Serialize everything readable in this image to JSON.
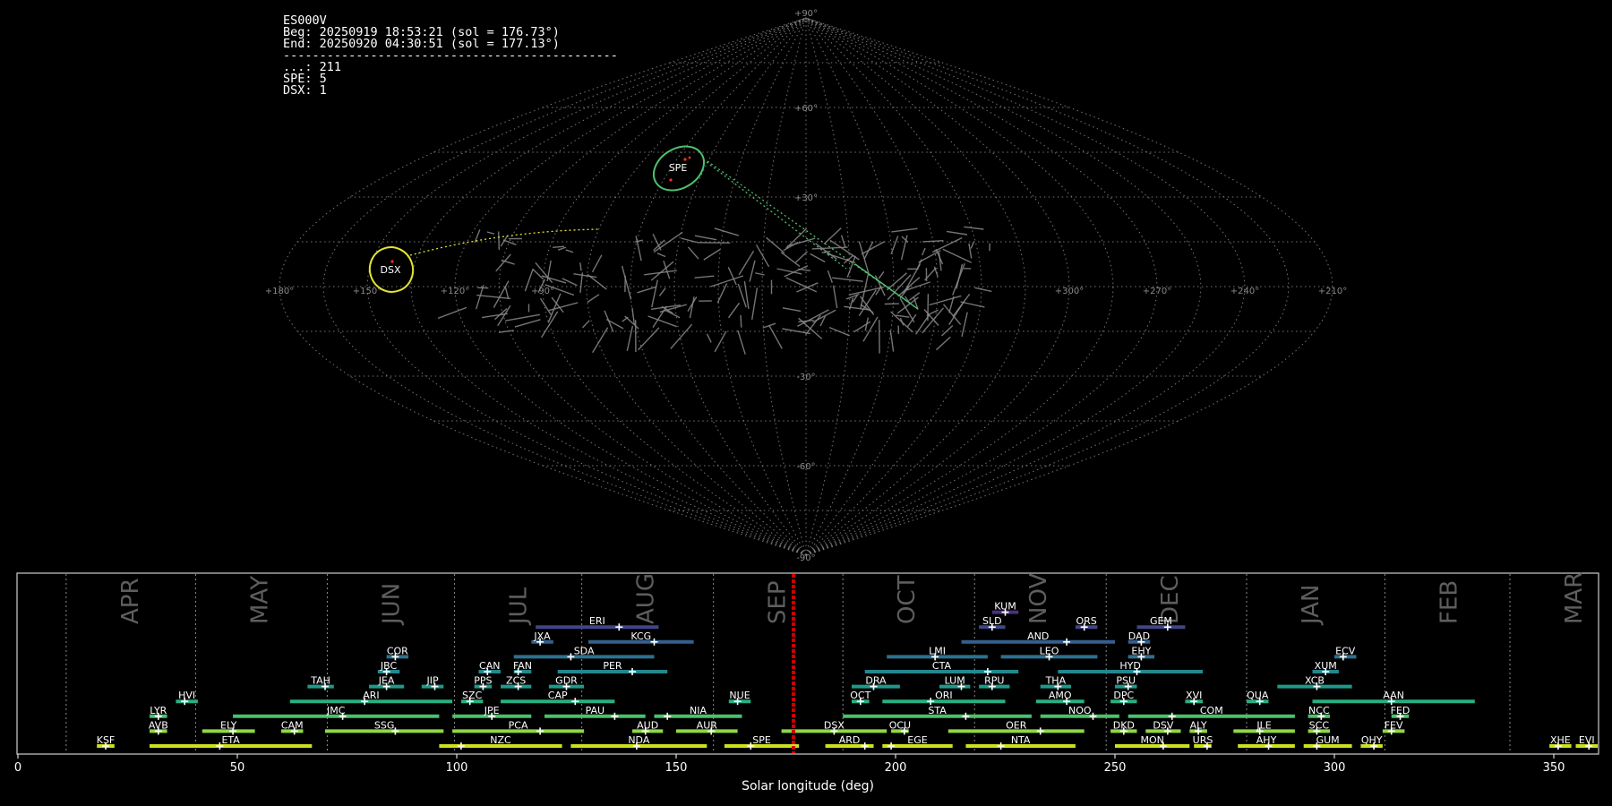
{
  "header": {
    "station": "ES000V",
    "begin": "Beg: 20250919 18:53:21 (sol = 176.73°)",
    "end": "End: 20250920 04:30:51 (sol = 177.13°)",
    "divider": "----------------------------------------------",
    "counts": [
      {
        "label": "...: 211"
      },
      {
        "label": "SPE: 5"
      },
      {
        "label": "DSX: 1"
      }
    ]
  },
  "colors": {
    "background": "#000000",
    "grid": "#8a8a8a",
    "sporadic_trail": "#8a8a8a",
    "spe_shower": "#4fc06e",
    "dsx_shower": "#e2e233",
    "current_sol_marker": "#cc0000",
    "radiant_point": "#ff3030"
  },
  "sky_map": {
    "projection": "sinusoidal all-sky (equal-area)",
    "grid": true,
    "lon_tick_labels": [
      "+180°",
      "+150°",
      "+120°",
      "+90°",
      "+300°",
      "+270°",
      "+240°",
      "+210°",
      "+180°"
    ],
    "lat_tick_labels": [
      "+90°",
      "+60°",
      "+30°",
      "-30°",
      "-60°",
      "-90°"
    ],
    "shower_radiants": [
      {
        "code": "SPE",
        "label": "SPE",
        "color": "#4fc06e"
      },
      {
        "code": "DSX",
        "label": "DSX",
        "color": "#e2e233"
      }
    ],
    "sporadic_meteor_count": 211
  },
  "chart_data": {
    "type": "timeline",
    "title": "",
    "xlabel": "Solar longitude (deg)",
    "ylabel": "",
    "xlim": [
      0,
      360
    ],
    "x_ticks": [
      0,
      50,
      100,
      150,
      200,
      250,
      300,
      350
    ],
    "current_solar_longitude": 176.73,
    "month_starts": [
      {
        "label": "APR",
        "sol": 11
      },
      {
        "label": "MAY",
        "sol": 40.5
      },
      {
        "label": "JUN",
        "sol": 70.5
      },
      {
        "label": "JUL",
        "sol": 99.5
      },
      {
        "label": "AUG",
        "sol": 128.5
      },
      {
        "label": "SEP",
        "sol": 158.5
      },
      {
        "label": "OCT",
        "sol": 188
      },
      {
        "label": "NOV",
        "sol": 218
      },
      {
        "label": "DEC",
        "sol": 248
      },
      {
        "label": "JAN",
        "sol": 280
      },
      {
        "label": "FEB",
        "sol": 311.5
      },
      {
        "label": "MAR",
        "sol": 340
      }
    ],
    "showers": [
      {
        "code": "KSF",
        "start": 18,
        "end": 22,
        "peak": 20,
        "row": 0
      },
      {
        "code": "ETA",
        "start": 30,
        "end": 67,
        "peak": 46,
        "row": 0
      },
      {
        "code": "NZC",
        "start": 96,
        "end": 124,
        "peak": 101,
        "row": 0
      },
      {
        "code": "NDA",
        "start": 126,
        "end": 157,
        "peak": 141,
        "row": 0
      },
      {
        "code": "SPE",
        "start": 161,
        "end": 178,
        "peak": 167,
        "row": 0
      },
      {
        "code": "ARD",
        "start": 184,
        "end": 195,
        "peak": 193,
        "row": 0
      },
      {
        "code": "EGE",
        "start": 197,
        "end": 213,
        "peak": 199,
        "row": 0
      },
      {
        "code": "NTA",
        "start": 216,
        "end": 241,
        "peak": 224,
        "row": 0
      },
      {
        "code": "MON",
        "start": 250,
        "end": 267,
        "peak": 261,
        "row": 0
      },
      {
        "code": "URS",
        "start": 268,
        "end": 272,
        "peak": 271,
        "row": 0
      },
      {
        "code": "AHY",
        "start": 278,
        "end": 291,
        "peak": 285,
        "row": 0
      },
      {
        "code": "GUM",
        "start": 293,
        "end": 304,
        "peak": 296,
        "row": 0
      },
      {
        "code": "QHY",
        "start": 306,
        "end": 311,
        "peak": 309,
        "row": 0
      },
      {
        "code": "XHE",
        "start": 349,
        "end": 354,
        "peak": 351,
        "row": 0
      },
      {
        "code": "EVI",
        "start": 355,
        "end": 360,
        "peak": 358,
        "row": 0
      },
      {
        "code": "AVB",
        "start": 30,
        "end": 34,
        "peak": 32,
        "row": 1
      },
      {
        "code": "ELY",
        "start": 42,
        "end": 54,
        "peak": 49,
        "row": 1
      },
      {
        "code": "CAM",
        "start": 60,
        "end": 65,
        "peak": 63,
        "row": 1
      },
      {
        "code": "SSG",
        "start": 70,
        "end": 97,
        "peak": 86,
        "row": 1
      },
      {
        "code": "PCA",
        "start": 99,
        "end": 129,
        "peak": 119,
        "row": 1
      },
      {
        "code": "AUD",
        "start": 140,
        "end": 147,
        "peak": 143,
        "row": 1
      },
      {
        "code": "AUR",
        "start": 150,
        "end": 164,
        "peak": 158,
        "row": 1
      },
      {
        "code": "DSX",
        "start": 174,
        "end": 198,
        "peak": 186,
        "row": 1
      },
      {
        "code": "OCU",
        "start": 199,
        "end": 203,
        "peak": 202,
        "row": 1
      },
      {
        "code": "OER",
        "start": 212,
        "end": 243,
        "peak": 233,
        "row": 1
      },
      {
        "code": "DKD",
        "start": 249,
        "end": 255,
        "peak": 252,
        "row": 1
      },
      {
        "code": "DSV",
        "start": 257,
        "end": 265,
        "peak": 262,
        "row": 1
      },
      {
        "code": "ALY",
        "start": 267,
        "end": 271,
        "peak": 269,
        "row": 1
      },
      {
        "code": "JLE",
        "start": 277,
        "end": 291,
        "peak": 283,
        "row": 1
      },
      {
        "code": "SCC",
        "start": 294,
        "end": 299,
        "peak": 296,
        "row": 1
      },
      {
        "code": "FEV",
        "start": 311,
        "end": 316,
        "peak": 313,
        "row": 1
      },
      {
        "code": "LYR",
        "start": 30,
        "end": 34,
        "peak": 32,
        "row": 2
      },
      {
        "code": "JMC",
        "start": 49,
        "end": 96,
        "peak": 74,
        "row": 2
      },
      {
        "code": "JPE",
        "start": 99,
        "end": 117,
        "peak": 108,
        "row": 2
      },
      {
        "code": "PAU",
        "start": 120,
        "end": 143,
        "peak": 136,
        "row": 2
      },
      {
        "code": "NIA",
        "start": 145,
        "end": 165,
        "peak": 148,
        "row": 2
      },
      {
        "code": "STA",
        "start": 188,
        "end": 231,
        "peak": 216,
        "row": 2
      },
      {
        "code": "NOO",
        "start": 233,
        "end": 251,
        "peak": 245,
        "row": 2
      },
      {
        "code": "COM",
        "start": 253,
        "end": 291,
        "peak": 263,
        "row": 2
      },
      {
        "code": "NCC",
        "start": 294,
        "end": 299,
        "peak": 297,
        "row": 2
      },
      {
        "code": "FED",
        "start": 313,
        "end": 317,
        "peak": 315,
        "row": 2
      },
      {
        "code": "HVI",
        "start": 36,
        "end": 41,
        "peak": 38,
        "row": 3
      },
      {
        "code": "ARI",
        "start": 62,
        "end": 99,
        "peak": 79,
        "row": 3
      },
      {
        "code": "SZC",
        "start": 101,
        "end": 106,
        "peak": 103,
        "row": 3
      },
      {
        "code": "CAP",
        "start": 110,
        "end": 136,
        "peak": 127,
        "row": 3
      },
      {
        "code": "NUE",
        "start": 162,
        "end": 167,
        "peak": 164,
        "row": 3
      },
      {
        "code": "OCT",
        "start": 190,
        "end": 194,
        "peak": 192,
        "row": 3
      },
      {
        "code": "ORI",
        "start": 197,
        "end": 225,
        "peak": 208,
        "row": 3
      },
      {
        "code": "AMO",
        "start": 232,
        "end": 243,
        "peak": 239,
        "row": 3
      },
      {
        "code": "DPC",
        "start": 249,
        "end": 255,
        "peak": 252,
        "row": 3
      },
      {
        "code": "XVI",
        "start": 266,
        "end": 270,
        "peak": 268,
        "row": 3
      },
      {
        "code": "QUA",
        "start": 280,
        "end": 285,
        "peak": 283,
        "row": 3
      },
      {
        "code": "AAN",
        "start": 295,
        "end": 332,
        "peak": 313,
        "row": 3
      },
      {
        "code": "TAH",
        "start": 66,
        "end": 72,
        "peak": 70,
        "row": 4
      },
      {
        "code": "JEA",
        "start": 80,
        "end": 88,
        "peak": 84,
        "row": 4
      },
      {
        "code": "JIP",
        "start": 92,
        "end": 97,
        "peak": 95,
        "row": 4
      },
      {
        "code": "PPS",
        "start": 104,
        "end": 108,
        "peak": 106,
        "row": 4
      },
      {
        "code": "ZCS",
        "start": 110,
        "end": 117,
        "peak": 114,
        "row": 4
      },
      {
        "code": "GDR",
        "start": 121,
        "end": 129,
        "peak": 125,
        "row": 4
      },
      {
        "code": "DRA",
        "start": 190,
        "end": 201,
        "peak": 195,
        "row": 4
      },
      {
        "code": "LUM",
        "start": 210,
        "end": 217,
        "peak": 215,
        "row": 4
      },
      {
        "code": "RPU",
        "start": 219,
        "end": 226,
        "peak": 222,
        "row": 4
      },
      {
        "code": "THA",
        "start": 233,
        "end": 240,
        "peak": 237,
        "row": 4
      },
      {
        "code": "PSU",
        "start": 250,
        "end": 255,
        "peak": 253,
        "row": 4
      },
      {
        "code": "XCB",
        "start": 287,
        "end": 304,
        "peak": 296,
        "row": 4
      },
      {
        "code": "JBC",
        "start": 82,
        "end": 87,
        "peak": 84,
        "row": 5
      },
      {
        "code": "CAN",
        "start": 105,
        "end": 110,
        "peak": 107,
        "row": 5
      },
      {
        "code": "FAN",
        "start": 113,
        "end": 117,
        "peak": 114,
        "row": 5
      },
      {
        "code": "PER",
        "start": 123,
        "end": 148,
        "peak": 140,
        "row": 5
      },
      {
        "code": "CTA",
        "start": 193,
        "end": 228,
        "peak": 221,
        "row": 5
      },
      {
        "code": "HYD",
        "start": 237,
        "end": 270,
        "peak": 255,
        "row": 5
      },
      {
        "code": "XUM",
        "start": 295,
        "end": 301,
        "peak": 298,
        "row": 5
      },
      {
        "code": "COR",
        "start": 84,
        "end": 89,
        "peak": 86,
        "row": 6
      },
      {
        "code": "SDA",
        "start": 113,
        "end": 145,
        "peak": 126,
        "row": 6
      },
      {
        "code": "LMI",
        "start": 198,
        "end": 221,
        "peak": 209,
        "row": 6
      },
      {
        "code": "LEO",
        "start": 224,
        "end": 246,
        "peak": 235,
        "row": 6
      },
      {
        "code": "EHY",
        "start": 253,
        "end": 259,
        "peak": 256,
        "row": 6
      },
      {
        "code": "ECV",
        "start": 300,
        "end": 305,
        "peak": 302,
        "row": 6
      },
      {
        "code": "JXA",
        "start": 117,
        "end": 122,
        "peak": 119,
        "row": 7
      },
      {
        "code": "KCG",
        "start": 130,
        "end": 154,
        "peak": 145,
        "row": 7
      },
      {
        "code": "AND",
        "start": 215,
        "end": 250,
        "peak": 239,
        "row": 7
      },
      {
        "code": "DAD",
        "start": 253,
        "end": 258,
        "peak": 256,
        "row": 7
      },
      {
        "code": "ERI",
        "start": 118,
        "end": 146,
        "peak": 137,
        "row": 8
      },
      {
        "code": "SLD",
        "start": 219,
        "end": 225,
        "peak": 222,
        "row": 8
      },
      {
        "code": "ORS",
        "start": 241,
        "end": 246,
        "peak": 243,
        "row": 8
      },
      {
        "code": "GEM",
        "start": 255,
        "end": 266,
        "peak": 262,
        "row": 8
      },
      {
        "code": "KUM",
        "start": 222,
        "end": 228,
        "peak": 225,
        "row": 9
      }
    ]
  }
}
